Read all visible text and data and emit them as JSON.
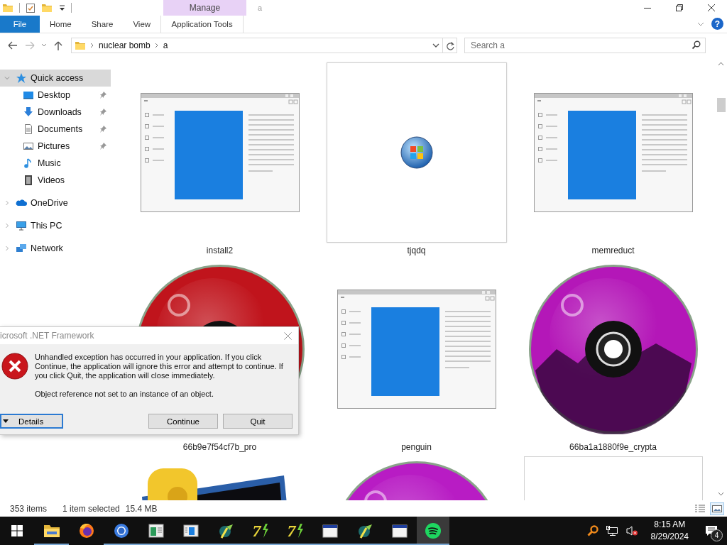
{
  "window": {
    "title": "a",
    "contextual_group": "Manage"
  },
  "ribbon": {
    "tabs": [
      {
        "label": "File",
        "kind": "file",
        "selected": false
      },
      {
        "label": "Home",
        "kind": "plain",
        "selected": false
      },
      {
        "label": "Share",
        "kind": "plain",
        "selected": false
      },
      {
        "label": "View",
        "kind": "plain",
        "selected": false
      },
      {
        "label": "Application Tools",
        "kind": "contextual",
        "selected": false
      }
    ],
    "help": "?"
  },
  "address_bar": {
    "path": [
      "nuclear bomb",
      "a"
    ]
  },
  "search": {
    "placeholder": "Search a"
  },
  "sidebar": {
    "items": [
      {
        "label": "Quick access",
        "expanded": true,
        "selected": true,
        "children": [
          {
            "label": "Desktop",
            "pinned": true,
            "selected": false
          },
          {
            "label": "Downloads",
            "pinned": true,
            "selected": false
          },
          {
            "label": "Documents",
            "pinned": true,
            "selected": false
          },
          {
            "label": "Pictures",
            "pinned": true,
            "selected": false
          },
          {
            "label": "Music",
            "pinned": false,
            "selected": false
          },
          {
            "label": "Videos",
            "pinned": false,
            "selected": false
          }
        ]
      },
      {
        "label": "OneDrive",
        "expanded": false,
        "selected": false
      },
      {
        "label": "This PC",
        "expanded": false,
        "selected": false
      },
      {
        "label": "Network",
        "expanded": false,
        "selected": false
      }
    ]
  },
  "files": {
    "items": [
      {
        "name": "install2",
        "kind": "window",
        "selected": false
      },
      {
        "name": "tjqdq",
        "kind": "orb",
        "selected": true
      },
      {
        "name": "memreduct",
        "kind": "window",
        "selected": false
      },
      {
        "name": "66b9e7f54cf7b_pro",
        "kind": "disc",
        "color": "#c0141c",
        "selected": false
      },
      {
        "name": "penguin",
        "kind": "window",
        "selected": false
      },
      {
        "name": "66ba1a1880f9e_crypta",
        "kind": "disc",
        "color": "#b417b8",
        "selected": false
      },
      {
        "kind": "picture",
        "selected": false
      },
      {
        "kind": "disc",
        "color": "#b81cc4",
        "selected": false
      },
      {
        "kind": "page",
        "selected": false
      }
    ]
  },
  "dialog": {
    "title": "icrosoft .NET Framework",
    "message": "Unhandled exception has occurred in your application. If you click Continue, the application will ignore this error and attempt to continue. If you click Quit, the application will close immediately.",
    "detail": "Object reference not set to an instance of an object.",
    "details_button": "Details",
    "buttons": [
      "Continue",
      "Quit"
    ]
  },
  "status_bar": {
    "item_count": "353 items",
    "selection": "1 item selected",
    "size": "15.4 MB",
    "views": [
      {
        "kind": "details",
        "selected": false
      },
      {
        "kind": "large-icons",
        "selected": true
      }
    ]
  },
  "taskbar": {
    "apps": [
      {
        "kind": "folder",
        "running": true,
        "active": false
      },
      {
        "kind": "flame-globe",
        "running": false,
        "active": false
      },
      {
        "kind": "ring",
        "running": true,
        "active": false
      },
      {
        "kind": "sheet-window",
        "running": true,
        "active": false
      },
      {
        "kind": "panel-window",
        "running": true,
        "active": false
      },
      {
        "kind": "tools",
        "running": true,
        "active": false
      },
      {
        "kind": "seven",
        "label": "7",
        "running": true,
        "active": false
      },
      {
        "kind": "seven",
        "label": "7",
        "running": true,
        "active": false
      },
      {
        "kind": "plain-window",
        "running": true,
        "active": false
      },
      {
        "kind": "tools",
        "running": true,
        "active": false
      },
      {
        "kind": "plain-window",
        "running": true,
        "active": false
      },
      {
        "kind": "waves",
        "running": true,
        "active": true
      }
    ],
    "time": "8:15 AM",
    "date": "8/29/2024",
    "notifications": "4"
  }
}
